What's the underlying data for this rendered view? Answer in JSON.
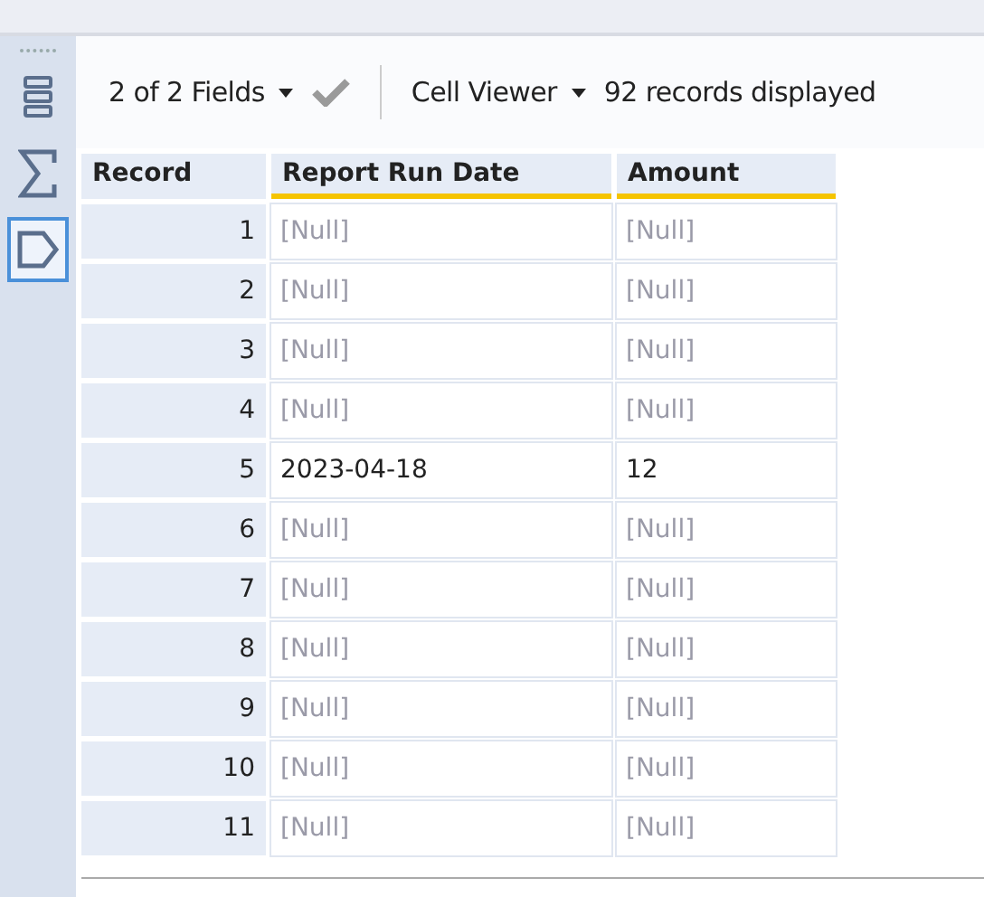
{
  "sidebar": {
    "items": [
      {
        "kind": "list",
        "selected": false
      },
      {
        "kind": "sigma",
        "selected": false
      },
      {
        "kind": "tag",
        "selected": true
      }
    ]
  },
  "toolbar": {
    "fields": "2 of 2 Fields",
    "viewer": "Cell Viewer",
    "records": "92 records displayed"
  },
  "table": {
    "columns": [
      "Record",
      "Report Run Date",
      "Amount"
    ],
    "rows": [
      {
        "cells": [
          {
            "text": "1",
            "kind": "record"
          },
          {
            "text": "[Null]",
            "kind": "null"
          },
          {
            "text": "[Null]",
            "kind": "null"
          }
        ]
      },
      {
        "cells": [
          {
            "text": "2",
            "kind": "record"
          },
          {
            "text": "[Null]",
            "kind": "null"
          },
          {
            "text": "[Null]",
            "kind": "null"
          }
        ]
      },
      {
        "cells": [
          {
            "text": "3",
            "kind": "record"
          },
          {
            "text": "[Null]",
            "kind": "null"
          },
          {
            "text": "[Null]",
            "kind": "null"
          }
        ]
      },
      {
        "cells": [
          {
            "text": "4",
            "kind": "record"
          },
          {
            "text": "[Null]",
            "kind": "null"
          },
          {
            "text": "[Null]",
            "kind": "null"
          }
        ]
      },
      {
        "cells": [
          {
            "text": "5",
            "kind": "record"
          },
          {
            "text": "2023-04-18",
            "kind": "value"
          },
          {
            "text": "12",
            "kind": "value"
          }
        ]
      },
      {
        "cells": [
          {
            "text": "6",
            "kind": "record"
          },
          {
            "text": "[Null]",
            "kind": "null"
          },
          {
            "text": "[Null]",
            "kind": "null"
          }
        ]
      },
      {
        "cells": [
          {
            "text": "7",
            "kind": "record"
          },
          {
            "text": "[Null]",
            "kind": "null"
          },
          {
            "text": "[Null]",
            "kind": "null"
          }
        ]
      },
      {
        "cells": [
          {
            "text": "8",
            "kind": "record"
          },
          {
            "text": "[Null]",
            "kind": "null"
          },
          {
            "text": "[Null]",
            "kind": "null"
          }
        ]
      },
      {
        "cells": [
          {
            "text": "9",
            "kind": "record"
          },
          {
            "text": "[Null]",
            "kind": "null"
          },
          {
            "text": "[Null]",
            "kind": "null"
          }
        ]
      },
      {
        "cells": [
          {
            "text": "10",
            "kind": "record"
          },
          {
            "text": "[Null]",
            "kind": "null"
          },
          {
            "text": "[Null]",
            "kind": "null"
          }
        ]
      },
      {
        "cells": [
          {
            "text": "11",
            "kind": "record"
          },
          {
            "text": "[Null]",
            "kind": "null"
          },
          {
            "text": "[Null]",
            "kind": "null"
          }
        ]
      }
    ]
  }
}
